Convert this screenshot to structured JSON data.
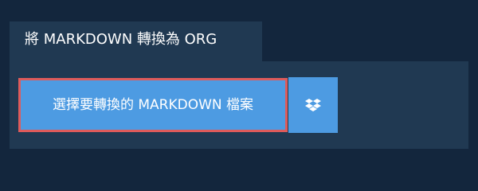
{
  "tab": {
    "label": "將 MARKDOWN 轉換為 ORG"
  },
  "upload": {
    "select_label": "選擇要轉換的 MARKDOWN 檔案",
    "dropbox_icon": "dropbox-icon"
  },
  "colors": {
    "page_background": "#13263d",
    "panel_background": "#203952",
    "button_background": "#4d9be2",
    "button_highlight_border": "#de5b5b",
    "text": "#ffffff"
  }
}
